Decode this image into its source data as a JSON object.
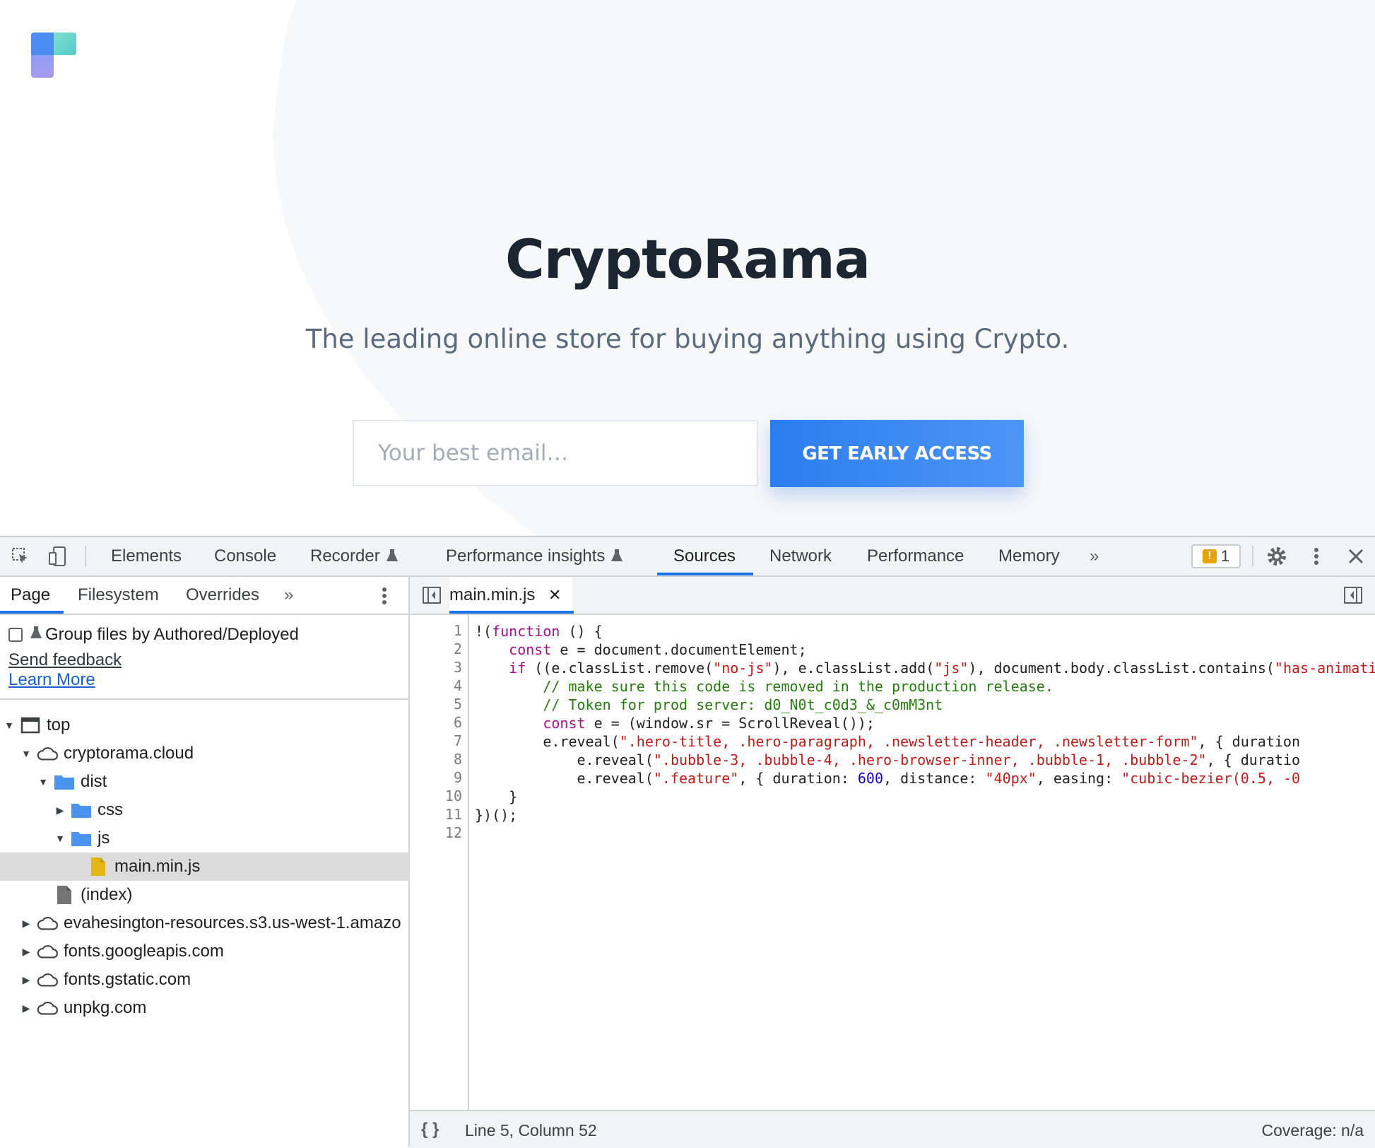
{
  "site": {
    "title": "CryptoRama",
    "subtitle": "The leading online store for buying anything using Crypto.",
    "email_placeholder": "Your best email…",
    "cta_label": "GET EARLY ACCESS",
    "colors": {
      "accent": "#2a7ef0",
      "title": "#1c2633",
      "background_shape": "#f6f8fa"
    }
  },
  "devtools": {
    "tabs": [
      "Elements",
      "Console",
      "Recorder",
      "Performance insights",
      "Sources",
      "Network",
      "Performance",
      "Memory"
    ],
    "active_tab": "Sources",
    "issues_count": "1",
    "navigator": {
      "tabs": [
        "Page",
        "Filesystem",
        "Overrides"
      ],
      "active_tab": "Page",
      "group_label": "Group files by Authored/Deployed",
      "send_feedback": "Send feedback",
      "learn_more": "Learn More",
      "tree": [
        "top",
        "cryptorama.cloud",
        "dist",
        "css",
        "js",
        "main.min.js",
        "(index)",
        "evahesington-resources.s3.us-west-1.amazo",
        "fonts.googleapis.com",
        "fonts.gstatic.com",
        "unpkg.com"
      ],
      "selected_file": "main.min.js"
    },
    "editor": {
      "open_file": "main.min.js",
      "line_numbers": [
        "1",
        "2",
        "3",
        "4",
        "5",
        "6",
        "7",
        "8",
        "9",
        "10",
        "11",
        "12"
      ],
      "status_position": "Line 5, Column 52",
      "coverage": "Coverage: n/a"
    }
  }
}
